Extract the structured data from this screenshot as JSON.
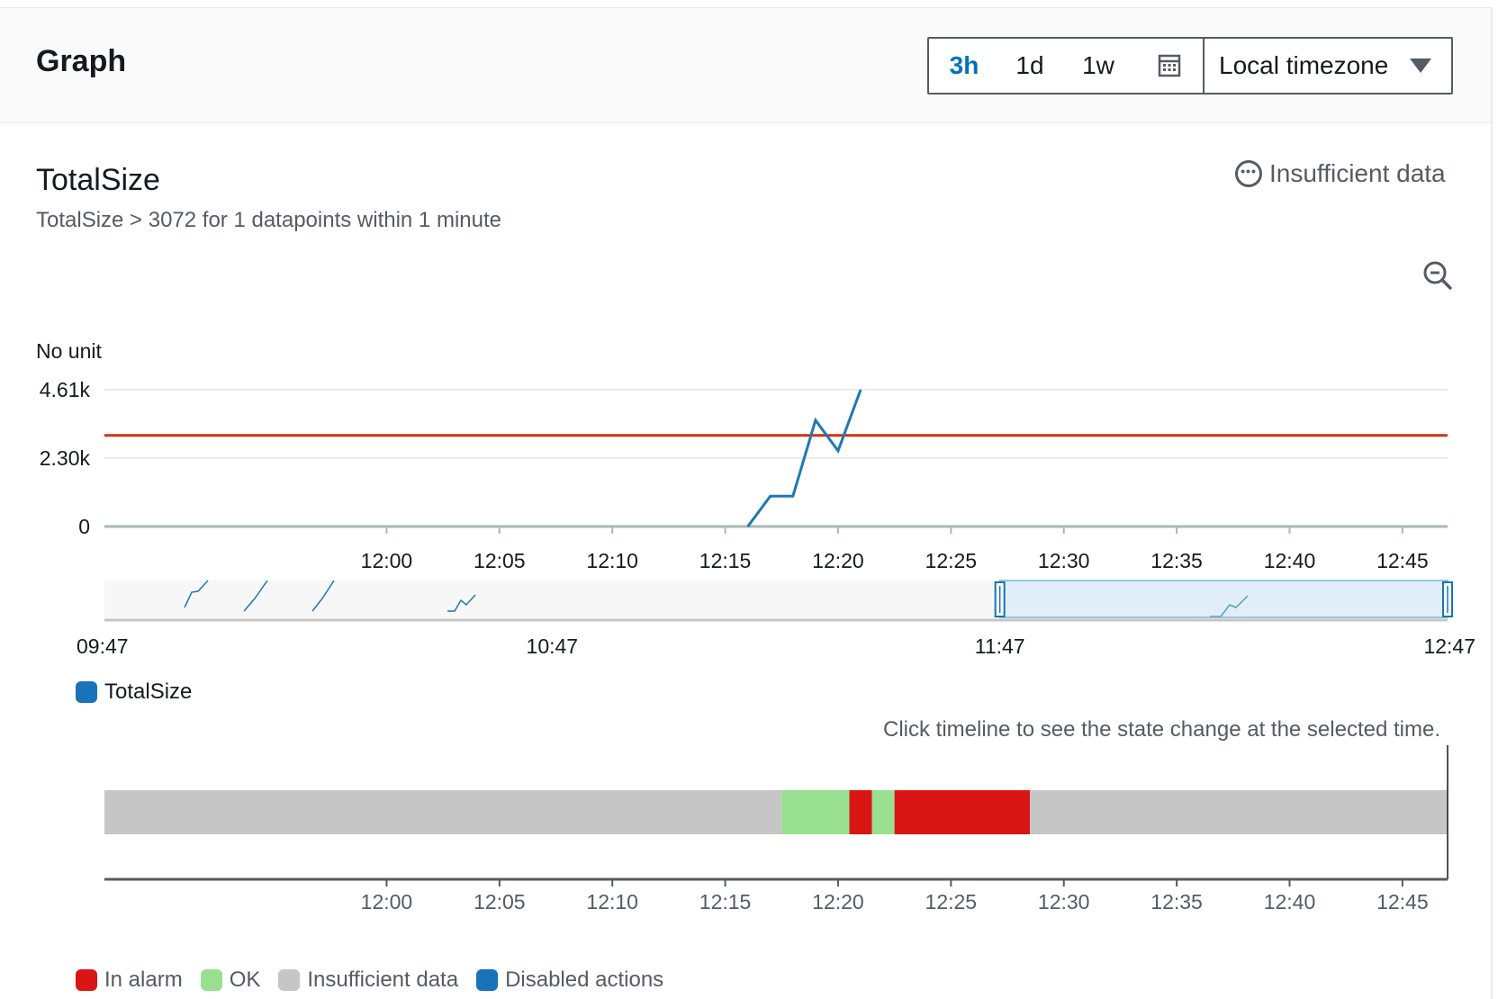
{
  "header": {
    "title": "Graph"
  },
  "time_range": {
    "options": [
      "3h",
      "1d",
      "1w"
    ],
    "selected": "3h",
    "calendar_icon": "calendar-icon",
    "timezone": "Local timezone"
  },
  "metric": {
    "title": "TotalSize",
    "condition": "TotalSize > 3072 for 1 datapoints within 1 minute",
    "state": "Insufficient data",
    "state_icon": "ellipsis-circle-icon",
    "zoom_icon": "zoom-out-icon"
  },
  "chart_data": [
    {
      "type": "line",
      "ylabel": "No unit",
      "ylim": [
        0,
        4610
      ],
      "y_tick_labels": [
        "4.61k",
        "2.30k",
        "0"
      ],
      "y_tick_values": [
        4610,
        2300,
        0
      ],
      "x_tick_labels": [
        "12:00",
        "12:05",
        "12:10",
        "12:15",
        "12:20",
        "12:25",
        "12:30",
        "12:35",
        "12:40",
        "12:45"
      ],
      "x_range": [
        "11:47:30",
        "12:47"
      ],
      "series": [
        {
          "name": "TotalSize",
          "color": "#1f77b4",
          "x": [
            "12:16",
            "12:17",
            "12:18",
            "12:19",
            "12:20",
            "12:21"
          ],
          "values": [
            0,
            1024,
            1024,
            3580,
            2550,
            4610
          ]
        }
      ],
      "threshold": {
        "value": 3072,
        "color": "#d13212"
      },
      "grid": true
    },
    {
      "type": "line",
      "role": "overview navigator",
      "x_tick_labels": [
        "09:47",
        "10:47",
        "11:47",
        "12:47"
      ],
      "selection": [
        "11:47",
        "12:47"
      ]
    },
    {
      "type": "area",
      "role": "alarm state timeline",
      "x_tick_labels": [
        "12:00",
        "12:05",
        "12:10",
        "12:15",
        "12:20",
        "12:25",
        "12:30",
        "12:35",
        "12:40",
        "12:45"
      ],
      "segments": [
        {
          "state": "Insufficient data",
          "start": "11:47:30",
          "end": "12:17:30"
        },
        {
          "state": "OK",
          "start": "12:17:30",
          "end": "12:20:30"
        },
        {
          "state": "In alarm",
          "start": "12:20:30",
          "end": "12:21:30"
        },
        {
          "state": "OK",
          "start": "12:21:30",
          "end": "12:22:30"
        },
        {
          "state": "In alarm",
          "start": "12:22:30",
          "end": "12:28:30"
        },
        {
          "state": "Insufficient data",
          "start": "12:28:30",
          "end": "12:47"
        }
      ]
    }
  ],
  "legend": {
    "series_name": "TotalSize",
    "series_color": "#1f77b4"
  },
  "timeline_hint": "Click timeline to see the state change at the selected time.",
  "state_legend": [
    {
      "label": "In alarm",
      "color": "#d91515"
    },
    {
      "label": "OK",
      "color": "#98e08f"
    },
    {
      "label": "Insufficient data",
      "color": "#c6c6c6"
    },
    {
      "label": "Disabled actions",
      "color": "#1a72b8"
    }
  ]
}
